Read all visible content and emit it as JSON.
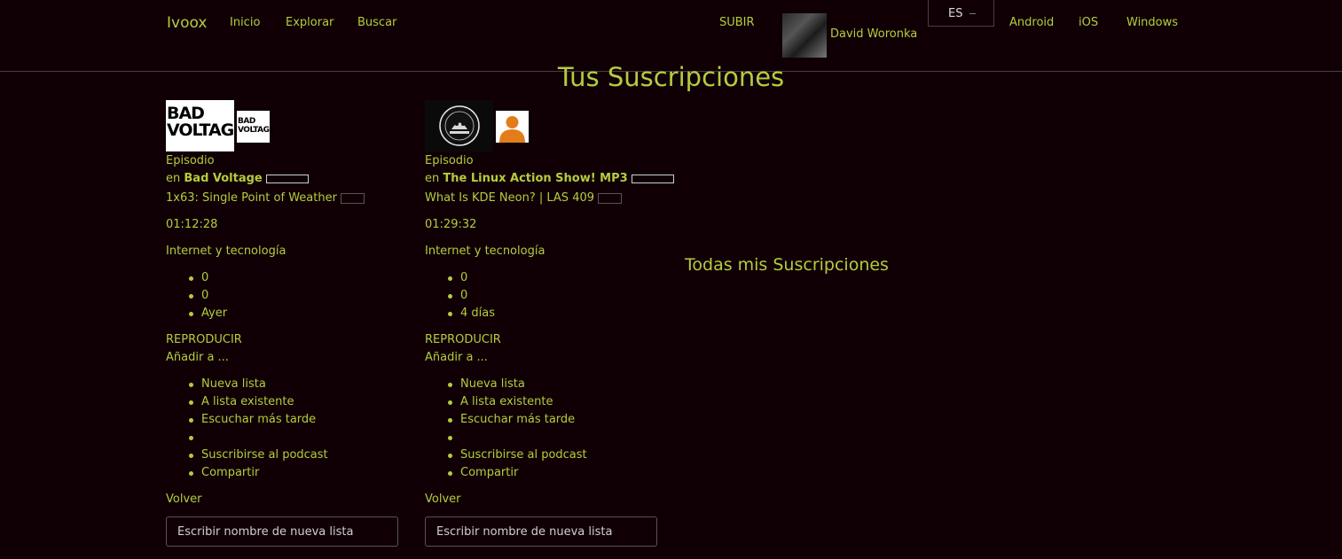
{
  "nav": {
    "brand": "Ivoox",
    "links": [
      "Inicio",
      "Explorar",
      "Buscar"
    ],
    "upload": "SUBIR",
    "user_name": "David Woronka",
    "language": "ES",
    "apps": [
      "Android",
      "iOS",
      "Windows"
    ]
  },
  "page_title": "Tus Suscripciones",
  "all_subscriptions": "Todas mis Suscripciones",
  "cards": [
    {
      "type_label": "Episodio",
      "in_prefix": "en",
      "podcast_name": "Bad Voltage",
      "thumb_text_line1": "BAD",
      "thumb_text_line2": "VOLTAGE",
      "episode_title": "1x63: Single Point of Weather",
      "duration": "01:12:28",
      "category": "Internet y tecnología",
      "stats": [
        "0",
        "0",
        "Ayer"
      ],
      "play": "REPRODUCIR",
      "add_to": "Añadir a ...",
      "menu": [
        "Nueva lista",
        "A lista existente",
        "Escuchar más tarde",
        "",
        "Suscribirse al podcast",
        "Compartir"
      ],
      "back": "Volver",
      "input_placeholder": "Escribir nombre de nueva lista"
    },
    {
      "type_label": "Episodio",
      "in_prefix": "en",
      "podcast_name": "The Linux Action Show! MP3",
      "episode_title": "What Is KDE Neon? | LAS 409",
      "duration": "01:29:32",
      "category": "Internet y tecnología",
      "stats": [
        "0",
        "0",
        "4 días"
      ],
      "play": "REPRODUCIR",
      "add_to": "Añadir a ...",
      "menu": [
        "Nueva lista",
        "A lista existente",
        "Escuchar más tarde",
        "",
        "Suscribirse al podcast",
        "Compartir"
      ],
      "back": "Volver",
      "input_placeholder": "Escribir nombre de nueva lista"
    }
  ],
  "colors": {
    "background": "#100005",
    "accent": "#b5cc3d",
    "divider": "#4a3e44",
    "avatar_orange": "#e27d1c"
  }
}
